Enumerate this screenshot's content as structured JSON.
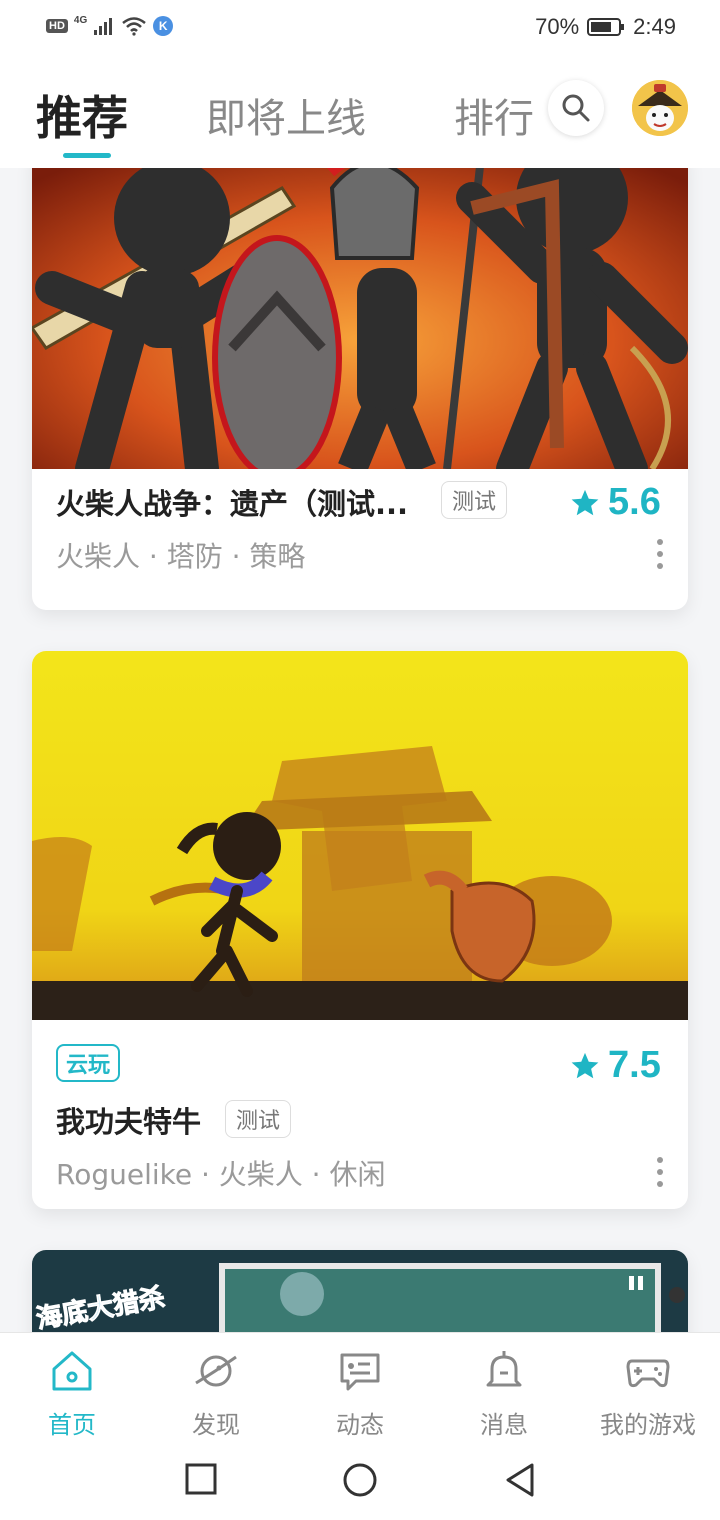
{
  "status_bar": {
    "hd": "HD",
    "network": "4G",
    "k_badge": "K",
    "battery": "70%",
    "time": "2:49"
  },
  "header": {
    "tabs": [
      {
        "label": "推荐",
        "active": true
      },
      {
        "label": "即将上线",
        "active": false
      },
      {
        "label": "排行",
        "active": false
      }
    ],
    "accent_color": "#23b8c8"
  },
  "games": [
    {
      "title": "火柴人战争：遗产（测试...",
      "badge": "测试",
      "rating": "5.6",
      "tags": "火柴人 · 塔防 · 策略"
    },
    {
      "cloud_badge": "云玩",
      "title": "我功夫特牛",
      "badge": "测试",
      "rating": "7.5",
      "tags": "Roguelike · 火柴人 · 休闲"
    },
    {
      "cover_text": "海底大猎杀"
    }
  ],
  "bottom_nav": [
    {
      "label": "首页",
      "icon": "home-icon",
      "active": true
    },
    {
      "label": "发现",
      "icon": "planet-icon",
      "active": false
    },
    {
      "label": "动态",
      "icon": "feed-icon",
      "active": false
    },
    {
      "label": "消息",
      "icon": "bell-icon",
      "active": false
    },
    {
      "label": "我的游戏",
      "icon": "gamepad-icon",
      "active": false
    }
  ]
}
